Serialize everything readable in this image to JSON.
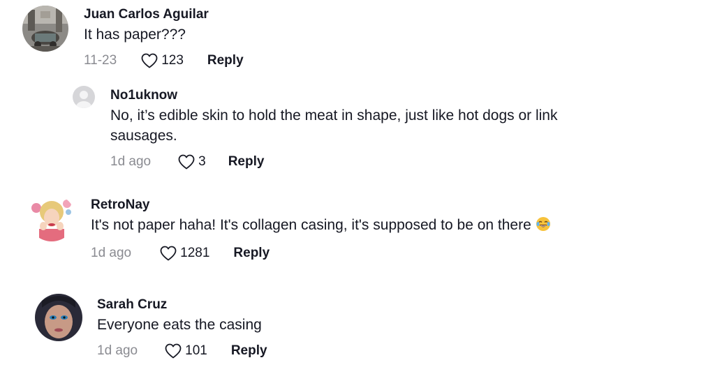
{
  "comments": [
    {
      "username": "Juan Carlos Aguilar",
      "text": "It has paper???",
      "date": "11-23",
      "likes": "123",
      "reply_label": "Reply"
    },
    {
      "username": "No1uknow",
      "text": "No, it’s edible skin to hold the meat in shape, just like hot dogs or link sausages.",
      "date": "1d ago",
      "likes": "3",
      "reply_label": "Reply"
    },
    {
      "username": "RetroNay",
      "text": "It's not paper haha! It's collagen casing, it's supposed to be on there",
      "date": "1d ago",
      "likes": "1281",
      "reply_label": "Reply",
      "emoji": "tears-of-joy-emoji"
    },
    {
      "username": "Sarah Cruz",
      "text": "Everyone eats the casing",
      "date": "1d ago",
      "likes": "101",
      "reply_label": "Reply"
    }
  ],
  "colors": {
    "text": "#161823",
    "secondary": "#8a8b91",
    "placeholder_avatar": "#d6d6d9"
  }
}
